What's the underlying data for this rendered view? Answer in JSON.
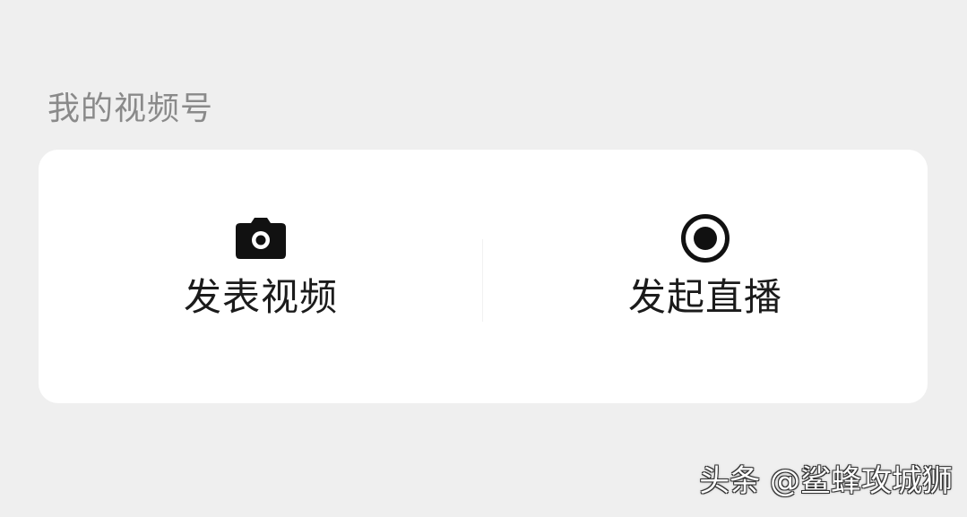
{
  "section": {
    "title": "我的视频号"
  },
  "actions": [
    {
      "label": "发表视频",
      "icon": "camera-icon"
    },
    {
      "label": "发起直播",
      "icon": "live-record-icon"
    }
  ],
  "watermark": "头条 @鲨蜂攻城狮",
  "colors": {
    "background": "#efefef",
    "card": "#ffffff",
    "title": "#8a8a8a",
    "label": "#1b1b1b",
    "icon": "#111111"
  }
}
